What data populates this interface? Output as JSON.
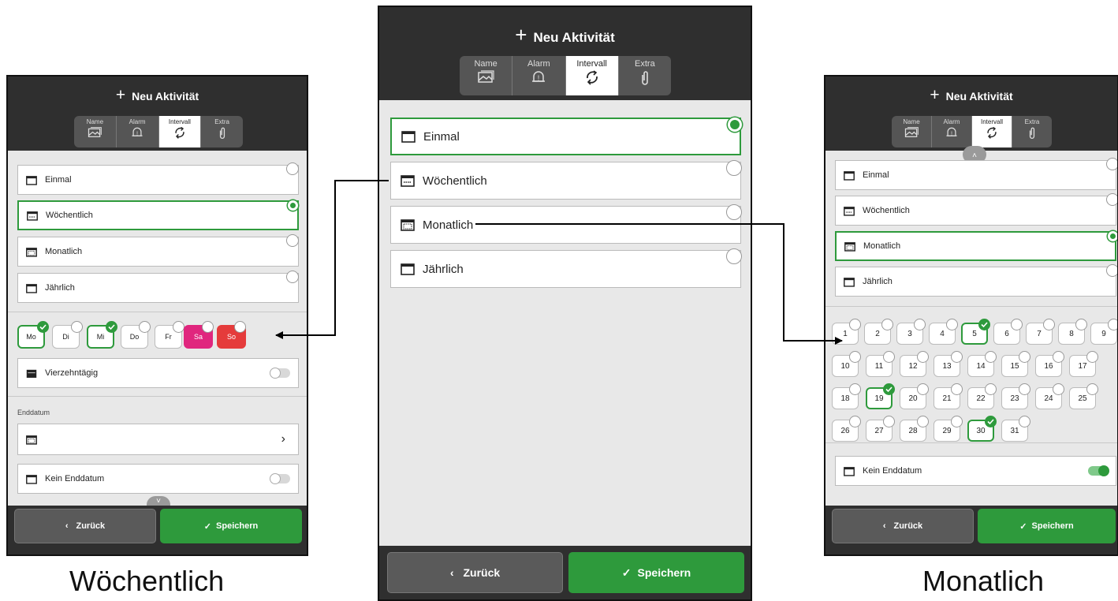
{
  "header": {
    "plus": "+",
    "title": "Neu Aktivität"
  },
  "tabs": [
    "Name",
    "Alarm",
    "Intervall",
    "Extra"
  ],
  "options": [
    "Einmal",
    "Wöchentlich",
    "Monatlich",
    "Jährlich"
  ],
  "footer": {
    "back_arrow": "‹",
    "back": "Zurück",
    "save_check": "✓",
    "save": "Speichern"
  },
  "weekly": {
    "days": [
      "Mo",
      "Di",
      "Mi",
      "Do",
      "Fr",
      "Sa",
      "So"
    ],
    "selected_days": [
      "Mo",
      "Mi"
    ],
    "fortnight": "Vierzehntägig",
    "end_label": "Enddatum",
    "end_arrow": "›",
    "no_end": "Kein Enddatum"
  },
  "monthly": {
    "days": [
      "1",
      "2",
      "3",
      "4",
      "5",
      "6",
      "7",
      "8",
      "9",
      "10",
      "11",
      "12",
      "13",
      "14",
      "15",
      "16",
      "17",
      "18",
      "19",
      "20",
      "21",
      "22",
      "23",
      "24",
      "25",
      "26",
      "27",
      "28",
      "29",
      "30",
      "31"
    ],
    "selected_days": [
      "5",
      "19",
      "30"
    ],
    "no_end": "Kein Enddatum"
  },
  "chevron_up": "˄",
  "chevron_down": "˅",
  "captions": {
    "left": "Wöchentlich",
    "right": "Monatlich"
  },
  "colors": {
    "header": "#2f2f2f",
    "accent": "#2e9a3c",
    "sa": "#e0267e",
    "so": "#e53b3b"
  }
}
